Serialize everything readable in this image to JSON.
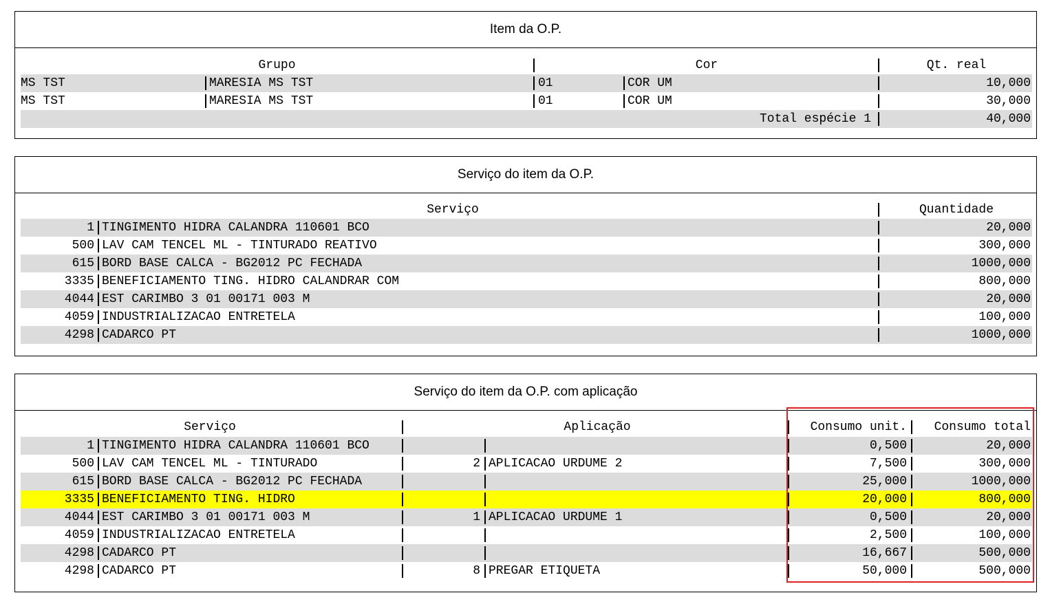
{
  "panel1": {
    "title": "Item da O.P.",
    "headers": {
      "grupo": "Grupo",
      "cor": "Cor",
      "qt_real": "Qt. real"
    },
    "rows": [
      {
        "grupo_cod": "MS TST",
        "grupo_desc": "MARESIA MS TST",
        "cor_cod": "01",
        "cor_desc": "COR UM",
        "qt": "10,000"
      },
      {
        "grupo_cod": "MS TST",
        "grupo_desc": "MARESIA MS TST",
        "cor_cod": "01",
        "cor_desc": "COR UM",
        "qt": "30,000"
      }
    ],
    "total_label": "Total espécie 1",
    "total_value": "40,000"
  },
  "panel2": {
    "title": "Serviço do item da O.P.",
    "headers": {
      "servico": "Serviço",
      "quantidade": "Quantidade"
    },
    "rows": [
      {
        "cod": "1",
        "desc": "TINGIMENTO HIDRA CALANDRA 110601 BCO",
        "qtd": "20,000"
      },
      {
        "cod": "500",
        "desc": "LAV CAM TENCEL ML - TINTURADO REATIVO",
        "qtd": "300,000"
      },
      {
        "cod": "615",
        "desc": "BORD BASE CALCA - BG2012 PC FECHADA",
        "qtd": "1000,000"
      },
      {
        "cod": "3335",
        "desc": "BENEFICIAMENTO TING. HIDRO CALANDRAR COM",
        "qtd": "800,000"
      },
      {
        "cod": "4044",
        "desc": "EST CARIMBO 3 01 00171 003 M",
        "qtd": "20,000"
      },
      {
        "cod": "4059",
        "desc": "INDUSTRIALIZACAO ENTRETELA",
        "qtd": "100,000"
      },
      {
        "cod": "4298",
        "desc": "CADARCO PT",
        "qtd": "1000,000"
      }
    ]
  },
  "panel3": {
    "title": "Serviço do item da O.P. com aplicação",
    "headers": {
      "servico": "Serviço",
      "aplicacao": "Aplicação",
      "consumo_unit": "Consumo unit.",
      "consumo_total": "Consumo total"
    },
    "rows": [
      {
        "cod": "1",
        "desc": "TINGIMENTO HIDRA CALANDRA 110601 BCO",
        "ap_cod": "",
        "ap_desc": "",
        "unit": "0,500",
        "total": "20,000"
      },
      {
        "cod": "500",
        "desc": "LAV CAM TENCEL ML - TINTURADO",
        "ap_cod": "2",
        "ap_desc": "APLICACAO URDUME 2",
        "unit": "7,500",
        "total": "300,000"
      },
      {
        "cod": "615",
        "desc": "BORD BASE CALCA - BG2012 PC FECHADA",
        "ap_cod": "",
        "ap_desc": "",
        "unit": "25,000",
        "total": "1000,000"
      },
      {
        "cod": "3335",
        "desc": "BENEFICIAMENTO TING. HIDRO",
        "ap_cod": "",
        "ap_desc": "",
        "unit": "20,000",
        "total": "800,000"
      },
      {
        "cod": "4044",
        "desc": "EST CARIMBO 3 01 00171 003 M",
        "ap_cod": "1",
        "ap_desc": "APLICACAO URDUME 1",
        "unit": "0,500",
        "total": "20,000"
      },
      {
        "cod": "4059",
        "desc": "INDUSTRIALIZACAO ENTRETELA",
        "ap_cod": "",
        "ap_desc": "",
        "unit": "2,500",
        "total": "100,000"
      },
      {
        "cod": "4298",
        "desc": "CADARCO PT",
        "ap_cod": "",
        "ap_desc": "",
        "unit": "16,667",
        "total": "500,000"
      },
      {
        "cod": "4298",
        "desc": "CADARCO PT",
        "ap_cod": "8",
        "ap_desc": "PREGAR ETIQUETA",
        "unit": "50,000",
        "total": "500,000"
      }
    ],
    "highlight_color": "#ffff00",
    "annotation_color": "#e02020"
  }
}
